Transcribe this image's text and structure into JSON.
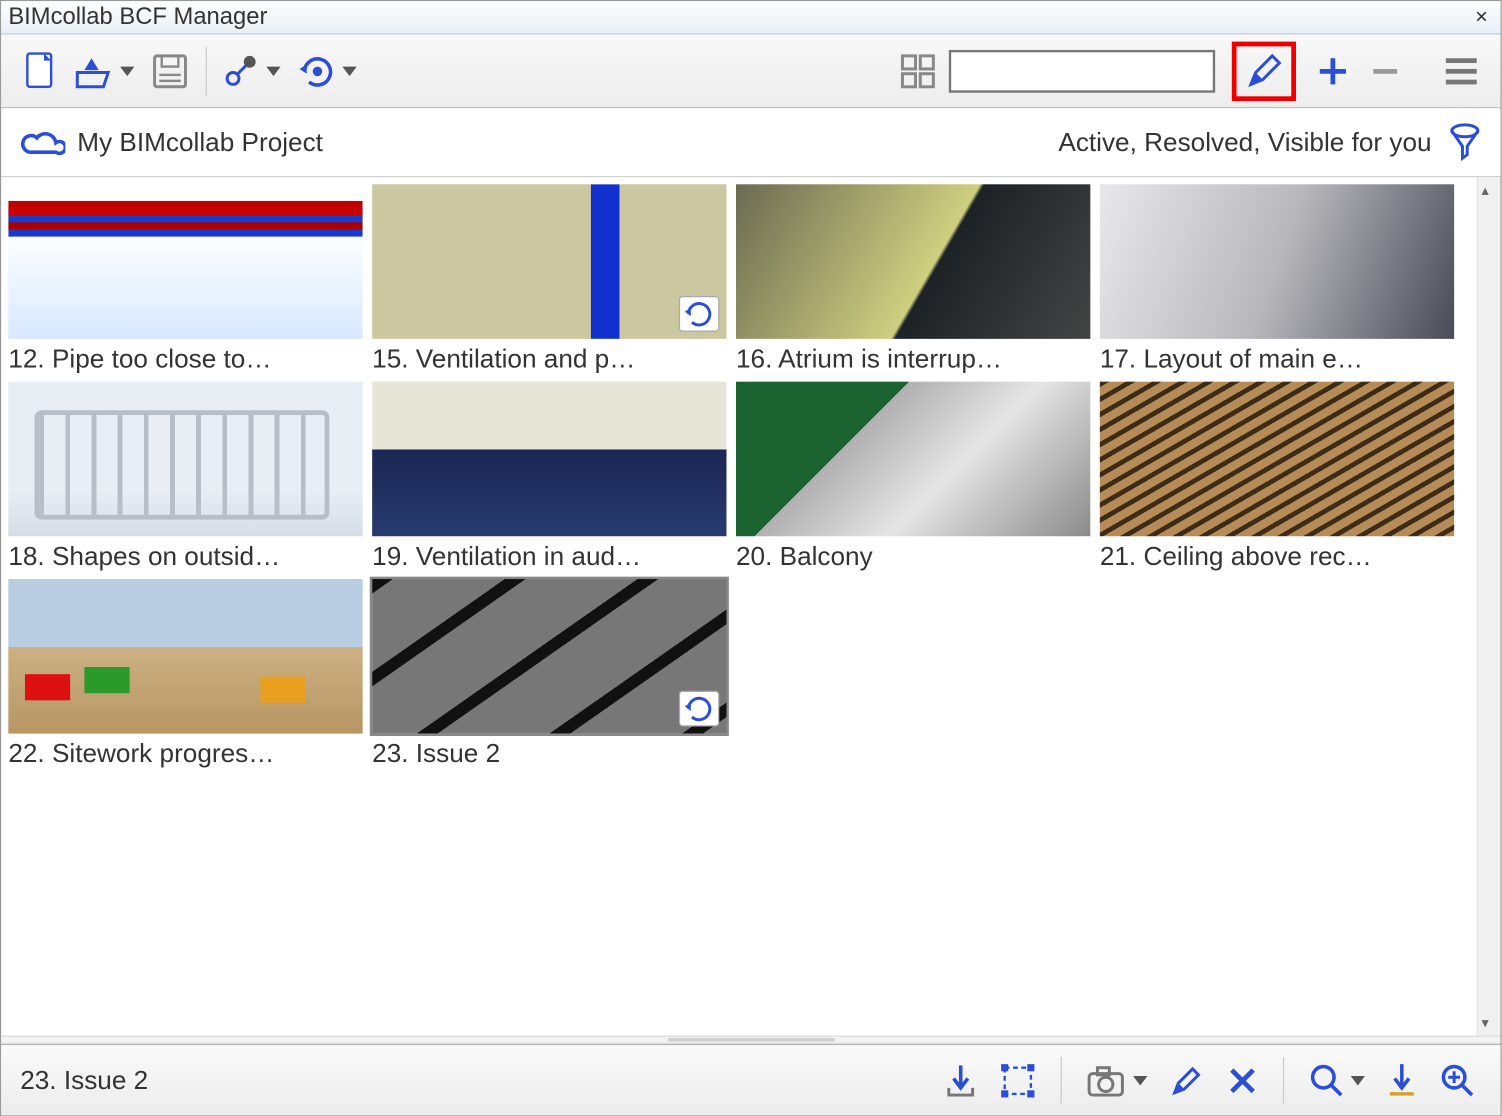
{
  "window": {
    "title": "BIMcollab BCF Manager"
  },
  "project": {
    "name": "My BIMcollab Project",
    "filter_text": "Active, Resolved, Visible for you"
  },
  "issues": [
    {
      "num": 12,
      "label": "12. Pipe too close to…",
      "sync_badge": false,
      "bg": "bg12"
    },
    {
      "num": 15,
      "label": "15. Ventilation and p…",
      "sync_badge": true,
      "bg": "bg15"
    },
    {
      "num": 16,
      "label": "16. Atrium is interrup…",
      "sync_badge": false,
      "bg": "bg16"
    },
    {
      "num": 17,
      "label": "17. Layout of main e…",
      "sync_badge": false,
      "bg": "bg17"
    },
    {
      "num": 18,
      "label": "18. Shapes on outsid…",
      "sync_badge": false,
      "bg": "bg18"
    },
    {
      "num": 19,
      "label": "19. Ventilation in aud…",
      "sync_badge": false,
      "bg": "bg19"
    },
    {
      "num": 20,
      "label": "20. Balcony",
      "sync_badge": false,
      "bg": "bg20"
    },
    {
      "num": 21,
      "label": "21. Ceiling above rec…",
      "sync_badge": false,
      "bg": "bg21"
    },
    {
      "num": 22,
      "label": "22. Sitework progres…",
      "sync_badge": false,
      "bg": "bg22"
    },
    {
      "num": 23,
      "label": "23. Issue 2",
      "sync_badge": true,
      "bg": "bg23",
      "selected": true
    }
  ],
  "selected_issue": {
    "label": "23. Issue 2"
  },
  "icons": {
    "doc": "doc",
    "open": "open",
    "save": "save",
    "share": "share",
    "sync": "sync",
    "grid": "grid",
    "search": "search",
    "pencil": "pencil",
    "plus": "plus",
    "minus": "minus",
    "menu": "menu",
    "cloud": "cloud",
    "funnel": "funnel",
    "download": "download",
    "select": "select",
    "camera": "camera",
    "cancel": "cancel",
    "zoom": "zoom",
    "baseline": "baseline",
    "zoomin": "zoomin"
  }
}
